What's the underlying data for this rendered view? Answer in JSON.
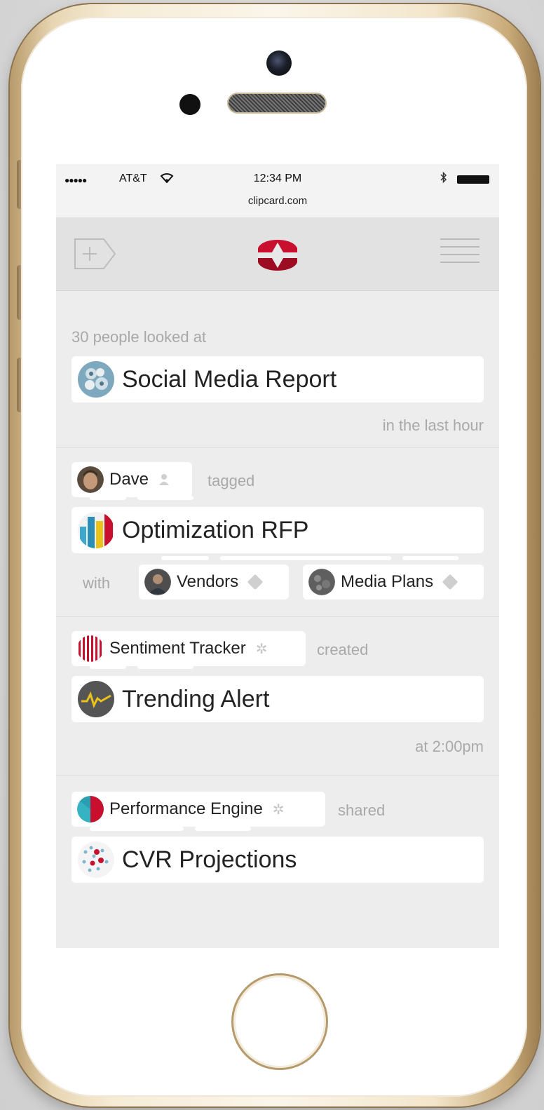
{
  "status_bar": {
    "signal": "●●●●●",
    "carrier": "AT&T",
    "time": "12:34 PM",
    "url": "clipcard.com"
  },
  "header": {
    "add_label": "+"
  },
  "feed": {
    "item1": {
      "prefix": "30 people looked at",
      "card_title": "Social Media Report",
      "suffix": "in the last hour"
    },
    "item2": {
      "actor": "Dave",
      "verb": "tagged",
      "card_title": "Optimization RFP",
      "with": "with",
      "tags": [
        "Vendors",
        "Media Plans"
      ]
    },
    "item3": {
      "actor": "Sentiment Tracker",
      "verb": "created",
      "card_title": "Trending Alert",
      "suffix": "at 2:00pm"
    },
    "item4": {
      "actor": "Performance Engine",
      "verb": "shared",
      "card_title": "CVR Projections"
    }
  },
  "colors": {
    "brand_red": "#c8102e",
    "screen_bg": "#ededed",
    "muted_text": "#a9a9a9"
  }
}
